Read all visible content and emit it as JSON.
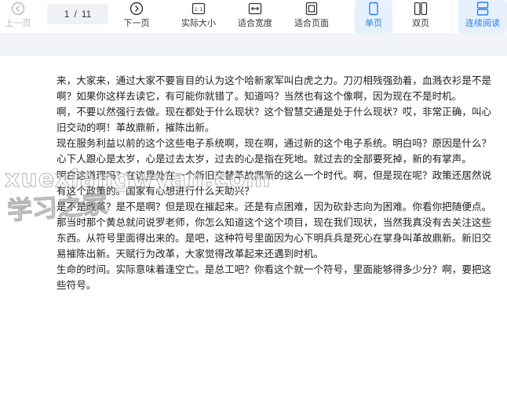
{
  "toolbar": {
    "prev_label": "上一页",
    "page_current": "1",
    "page_sep": "/",
    "page_total": "11",
    "next_label": "下一页",
    "actual_size_label": "实际大小",
    "fit_width_label": "适合宽度",
    "fit_page_label": "适合页面",
    "single_page_label": "单页",
    "double_page_label": "双页",
    "continuous_label": "连续阅读",
    "accent_color": "#2a7ff7"
  },
  "watermark": {
    "text_top": "xuexiangwyan.com",
    "text_bottom": "学习之家"
  },
  "document": {
    "paragraphs": [
      "来，大家来，通过大家不要盲目的认为这个哈新家军叫白虎之力。刀刃相残强劲着，血溅衣衫是不是啊？如果你这样去读它，有可能你就错了。知道吗？当然也有这个像啊，因为现在不是时机。",
      "啊，不要以然强行去做。现在都处于什么现状？这个智慧交通是处于什么现状？哎，非常正确，叫心旧交动的啊！革故鼎新，摧陈出新。",
      "现在服务利益以前的这个这些电子系统啊，现在啊，通过新的这个电子系统。明白吗？原因是什么？心下人跟心是太岁，心是过去太岁，过去的心是指在死地。就过去的全部要死掉，新的有掌声。",
      "明白这道理吗？在这里处在一个新旧交替革故鼎新的这么一个时代。啊，但是现在呢？政策还居然说有这个政策的。国家有心想进行什么天助兴？",
      "是不是改革？是不是啊？但是现在摧起来。还是有点困难，因为砍卦志向为困难。你看你把随便点。",
      "那当时那个黄总就问说罗老师，你怎么知道这个这个项目，现在我们现状，当然我真没有去关注这些东西。从符号里面得出来的。是吧，这种符号里面因为心下明兵兵是死心在掌身叫革故鼎新。新旧交易摧陈出新。天赋行为改革，大家觉得改革起来还遇到时机。",
      "生命的时间。实际意味着逢空亡。是总工吧？你看这个就一个符号，里面能够得多少分？啊，要把这些符号。"
    ]
  }
}
